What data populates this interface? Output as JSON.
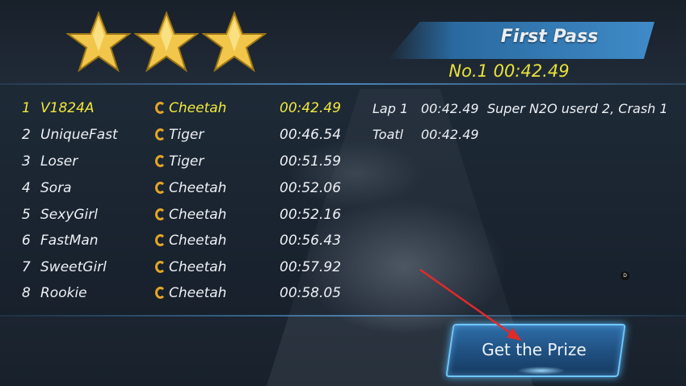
{
  "banner": {
    "title": "First Pass",
    "record": "No.1 00:42.49"
  },
  "stars": {
    "count": 3,
    "color": "#f1c64a"
  },
  "results": [
    {
      "rank": "1",
      "name": "V1824A",
      "car": "Cheetah",
      "time": "00:42.49",
      "highlight": true
    },
    {
      "rank": "2",
      "name": "UniqueFast",
      "car": "Tiger",
      "time": "00:46.54",
      "highlight": false
    },
    {
      "rank": "3",
      "name": "Loser",
      "car": "Tiger",
      "time": "00:51.59",
      "highlight": false
    },
    {
      "rank": "4",
      "name": "Sora",
      "car": "Cheetah",
      "time": "00:52.06",
      "highlight": false
    },
    {
      "rank": "5",
      "name": "SexyGirl",
      "car": "Cheetah",
      "time": "00:52.16",
      "highlight": false
    },
    {
      "rank": "6",
      "name": "FastMan",
      "car": "Cheetah",
      "time": "00:56.43",
      "highlight": false
    },
    {
      "rank": "7",
      "name": "SweetGirl",
      "car": "Cheetah",
      "time": "00:57.92",
      "highlight": false
    },
    {
      "rank": "8",
      "name": "Rookie",
      "car": "Cheetah",
      "time": "00:58.05",
      "highlight": false
    }
  ],
  "laps": {
    "lap1_label": "Lap 1",
    "lap1_time": "00:42.49",
    "lap1_note": "Super N2O userd 2, Crash 1",
    "total_label": "Toatl",
    "total_time": "00:42.49"
  },
  "prize_button": {
    "label": "Get the Prize"
  },
  "cursor_marker": {
    "label": "D"
  },
  "colors": {
    "highlight": "#f2e93a",
    "accent": "#3f8bc8",
    "icon": "#e2a628",
    "arrow": "#e02a2a"
  }
}
